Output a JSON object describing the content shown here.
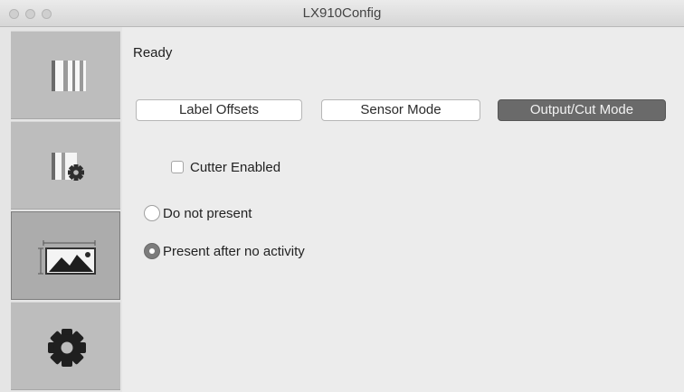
{
  "window": {
    "title": "LX910Config"
  },
  "sidebar": {
    "items": [
      {
        "icon": "label-stock-icon",
        "selected": false
      },
      {
        "icon": "label-settings-icon",
        "selected": false
      },
      {
        "icon": "output-cut-icon",
        "selected": true
      },
      {
        "icon": "gear-icon",
        "selected": false
      }
    ]
  },
  "main": {
    "status": "Ready",
    "tabs": [
      {
        "label": "Label Offsets",
        "active": false
      },
      {
        "label": "Sensor Mode",
        "active": false
      },
      {
        "label": "Output/Cut Mode",
        "active": true
      }
    ],
    "cutter": {
      "label": "Cutter Enabled",
      "checked": false
    },
    "present_options": [
      {
        "label": "Do not present",
        "selected": false
      },
      {
        "label": "Present after no activity",
        "selected": true
      }
    ]
  }
}
